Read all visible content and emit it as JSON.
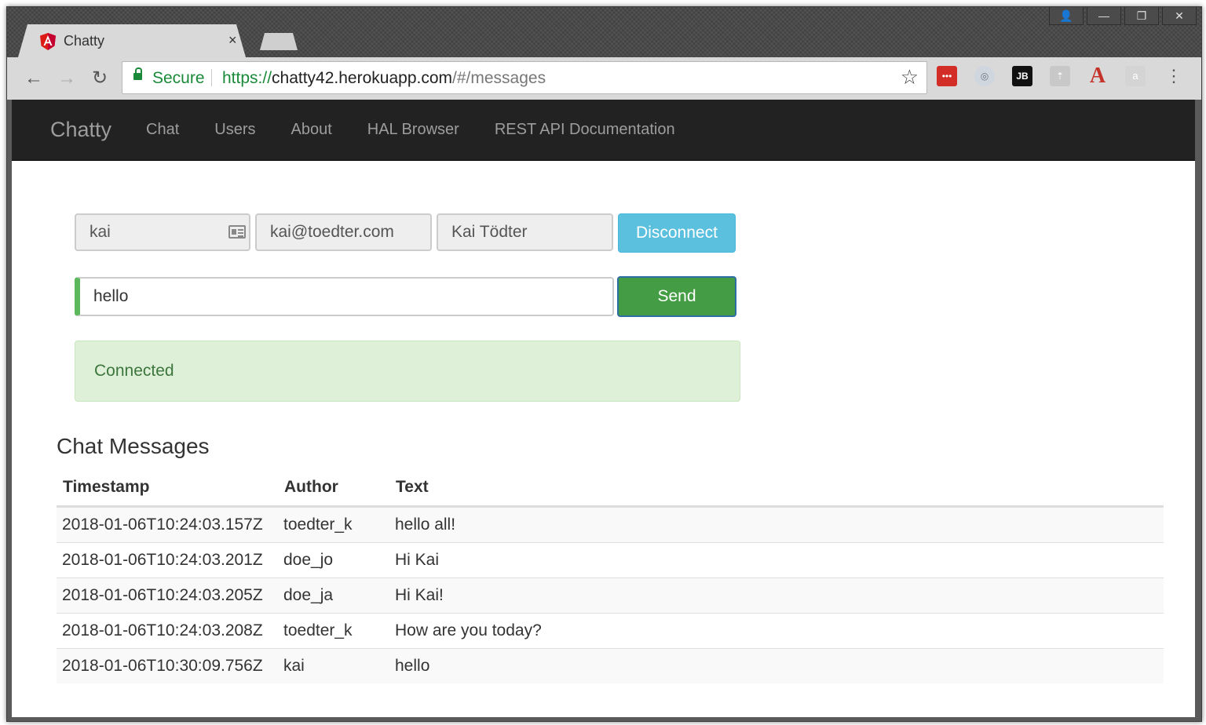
{
  "browser": {
    "tab": {
      "title": "Chatty",
      "close": "×"
    },
    "window_buttons": [
      "👤",
      "—",
      "❐",
      "✕"
    ],
    "address": {
      "secure_label": "Secure",
      "scheme": "https://",
      "host": "chatty42.herokuapp.com",
      "path": "/#/messages"
    },
    "extensions": [
      {
        "name": "lastpass-icon",
        "label": "•••",
        "bg": "#d32d27",
        "fg": "#ffffff"
      },
      {
        "name": "sync-icon",
        "label": "◎",
        "bg": "#cfd6de",
        "fg": "#6a7480"
      },
      {
        "name": "jetbrains-icon",
        "label": "JB",
        "bg": "#111111",
        "fg": "#ffffff"
      },
      {
        "name": "tab-icon",
        "label": "⇡",
        "bg": "#c8c8c8",
        "fg": "#ffffff"
      },
      {
        "name": "adobe-acrobat-icon",
        "label": "A",
        "bg": "transparent",
        "fg": "#c5322a"
      },
      {
        "name": "amazon-icon",
        "label": "a",
        "bg": "#d4d4d4",
        "fg": "#ffffff"
      }
    ]
  },
  "navbar": {
    "brand": "Chatty",
    "links": [
      "Chat",
      "Users",
      "About",
      "HAL Browser",
      "REST API Documentation"
    ]
  },
  "form": {
    "username": "kai",
    "email": "kai@toedter.com",
    "full_name": "Kai Tödter",
    "disconnect_label": "Disconnect",
    "message_value": "hello",
    "send_label": "Send"
  },
  "status": {
    "text": "Connected"
  },
  "messages": {
    "title": "Chat Messages",
    "columns": [
      "Timestamp",
      "Author",
      "Text"
    ],
    "rows": [
      [
        "2018-01-06T10:24:03.157Z",
        "toedter_k",
        "hello all!"
      ],
      [
        "2018-01-06T10:24:03.201Z",
        "doe_jo",
        "Hi Kai"
      ],
      [
        "2018-01-06T10:24:03.205Z",
        "doe_ja",
        "Hi Kai!"
      ],
      [
        "2018-01-06T10:24:03.208Z",
        "toedter_k",
        "How are you today?"
      ],
      [
        "2018-01-06T10:30:09.756Z",
        "kai",
        "hello"
      ]
    ]
  },
  "colors": {
    "navbar_bg": "#222222",
    "disconnect": "#5bc0de",
    "send": "#449d44",
    "alert_bg": "#dff0d8",
    "secure": "#1a8a3a"
  }
}
